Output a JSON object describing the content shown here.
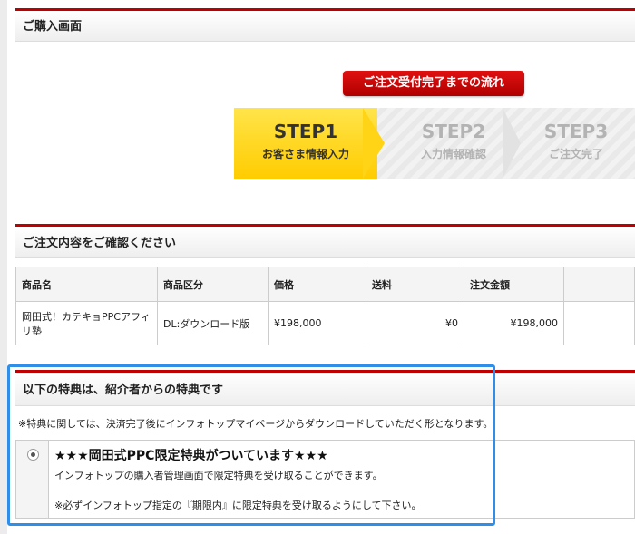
{
  "purchase_header": "ご購入画面",
  "flow_badge": "ご注文受付完了までの流れ",
  "steps": [
    {
      "num": "STEP1",
      "label": "お客さま情報入力",
      "active": true
    },
    {
      "num": "STEP2",
      "label": "入力情報確認",
      "active": false
    },
    {
      "num": "STEP3",
      "label": "ご注文完了",
      "active": false
    }
  ],
  "confirm_header": "ご注文内容をご確認ください",
  "table": {
    "headers": [
      "商品名",
      "商品区分",
      "価格",
      "送料",
      "注文金額"
    ],
    "row": {
      "product": "岡田式！カテキョPPCアフィリ塾",
      "category": "DL:ダウンロード版",
      "price": "¥198,000",
      "shipping": "¥0",
      "total": "¥198,000"
    }
  },
  "bonus_header": "以下の特典は、紹介者からの特典です",
  "bonus_note": "※特典に関しては、決済完了後にインフォトップマイページからダウンロードしていただく形となります。",
  "bonus": {
    "title": "★★★岡田式PPC限定特典がついています★★★",
    "desc": "インフォトップの購入者管理画面で限定特典を受け取ることができます。",
    "warn": "※必ずインフォトップ指定の『期限内』に限定特典を受け取るようにして下さい。"
  },
  "colors": {
    "accent": "#c00000",
    "step_active": "#ffcc00",
    "highlight": "#2f8fe8"
  }
}
